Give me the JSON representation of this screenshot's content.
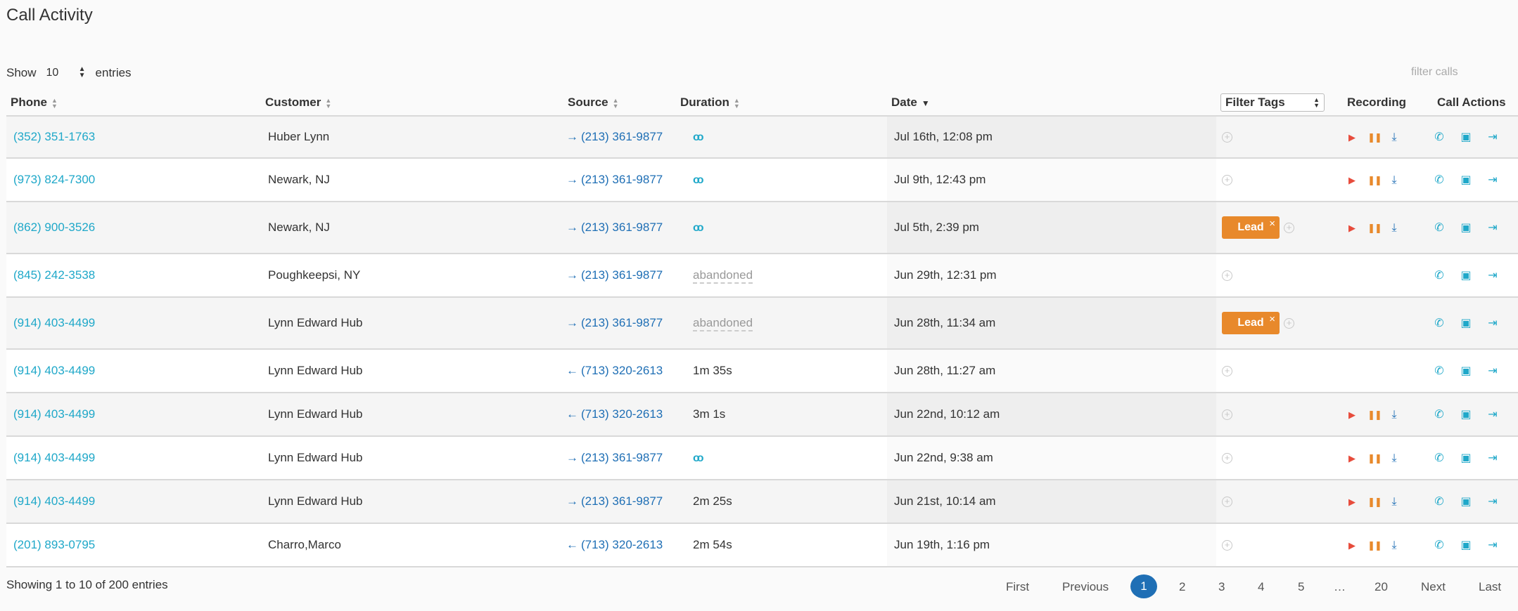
{
  "header": {
    "title": "Call Activity"
  },
  "controls": {
    "show_label": "Show",
    "entries_value": "10",
    "entries_label": "entries",
    "filter_placeholder": "filter calls"
  },
  "columns": {
    "phone": "Phone",
    "customer": "Customer",
    "source": "Source",
    "duration": "Duration",
    "date": "Date",
    "filter_tags": "Filter Tags",
    "recording": "Recording",
    "call_actions": "Call Actions"
  },
  "rows": [
    {
      "phone": "(352) 351-1763",
      "customer": "Huber Lynn",
      "direction": "→",
      "source": "(213) 361-9877",
      "duration": "voicemail",
      "date": "Jul 16th, 12:08 pm",
      "tag": "",
      "has_recording": true
    },
    {
      "phone": "(973) 824-7300",
      "customer": "Newark, NJ",
      "direction": "→",
      "source": "(213) 361-9877",
      "duration": "voicemail",
      "date": "Jul 9th, 12:43 pm",
      "tag": "",
      "has_recording": true
    },
    {
      "phone": "(862) 900-3526",
      "customer": "Newark, NJ",
      "direction": "→",
      "source": "(213) 361-9877",
      "duration": "voicemail",
      "date": "Jul 5th, 2:39 pm",
      "tag": "Lead",
      "has_recording": true
    },
    {
      "phone": "(845) 242-3538",
      "customer": "Poughkeepsi, NY",
      "direction": "→",
      "source": "(213) 361-9877",
      "duration": "abandoned",
      "date": "Jun 29th, 12:31 pm",
      "tag": "",
      "has_recording": false
    },
    {
      "phone": "(914) 403-4499",
      "customer": "Lynn Edward Hub",
      "direction": "→",
      "source": "(213) 361-9877",
      "duration": "abandoned",
      "date": "Jun 28th, 11:34 am",
      "tag": "Lead",
      "has_recording": false
    },
    {
      "phone": "(914) 403-4499",
      "customer": "Lynn Edward Hub",
      "direction": "←",
      "source": "(713) 320-2613",
      "duration": "1m 35s",
      "date": "Jun 28th, 11:27 am",
      "tag": "",
      "has_recording": false
    },
    {
      "phone": "(914) 403-4499",
      "customer": "Lynn Edward Hub",
      "direction": "←",
      "source": "(713) 320-2613",
      "duration": "3m 1s",
      "date": "Jun 22nd, 10:12 am",
      "tag": "",
      "has_recording": true
    },
    {
      "phone": "(914) 403-4499",
      "customer": "Lynn Edward Hub",
      "direction": "→",
      "source": "(213) 361-9877",
      "duration": "voicemail",
      "date": "Jun 22nd, 9:38 am",
      "tag": "",
      "has_recording": true
    },
    {
      "phone": "(914) 403-4499",
      "customer": "Lynn Edward Hub",
      "direction": "→",
      "source": "(213) 361-9877",
      "duration": "2m 25s",
      "date": "Jun 21st, 10:14 am",
      "tag": "",
      "has_recording": true
    },
    {
      "phone": "(201) 893-0795",
      "customer": "Charro,Marco",
      "direction": "←",
      "source": "(713) 320-2613",
      "duration": "2m 54s",
      "date": "Jun 19th, 1:16 pm",
      "tag": "",
      "has_recording": true
    }
  ],
  "icons": {
    "sort": "sort-icon",
    "voicemail": "voicemail-icon",
    "add_tag": "plus-circle-icon",
    "play": "play-icon",
    "pause": "pause-icon",
    "download": "download-icon",
    "call": "phone-icon",
    "sms": "chat-icon",
    "transfer": "transfer-icon"
  },
  "colors": {
    "link": "#1fa8c9",
    "source_link": "#1f6fb5",
    "tag_lead": "#e8892b",
    "play": "#e74c3c",
    "pause": "#e8892b",
    "pager_current": "#1f6fb5"
  },
  "pagination": {
    "summary": "Showing 1 to 10 of 200 entries",
    "first": "First",
    "previous": "Previous",
    "pages": [
      "1",
      "2",
      "3",
      "4",
      "5",
      "…",
      "20"
    ],
    "current": "1",
    "next": "Next",
    "last": "Last"
  }
}
